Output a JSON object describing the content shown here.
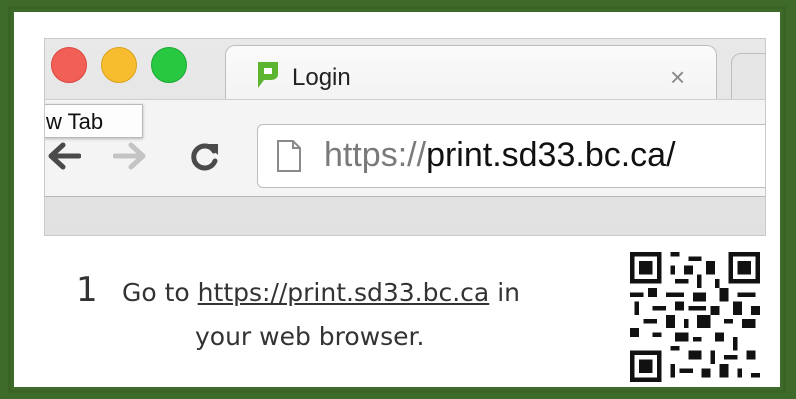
{
  "browser": {
    "tab": {
      "title": "Login",
      "close_glyph": "×",
      "favicon": "papercut-logo-icon"
    },
    "tooltip": "w Tab",
    "address_bar": {
      "scheme": "https://",
      "host": "print.sd33.bc.ca/"
    },
    "window_controls": [
      "close",
      "minimize",
      "maximize"
    ],
    "icons": [
      "back-icon",
      "forward-icon",
      "reload-icon",
      "page-icon"
    ]
  },
  "instruction": {
    "step_number": "1",
    "text_before": "Go to ",
    "link_text": "https://print.sd33.bc.ca",
    "text_after": " in",
    "line2": "your web browser."
  },
  "colors": {
    "frame": "#3f6b2a",
    "close": "#f25f57",
    "minimize": "#f7bd2f",
    "maximize": "#28c841",
    "favicon": "#5cb531"
  }
}
